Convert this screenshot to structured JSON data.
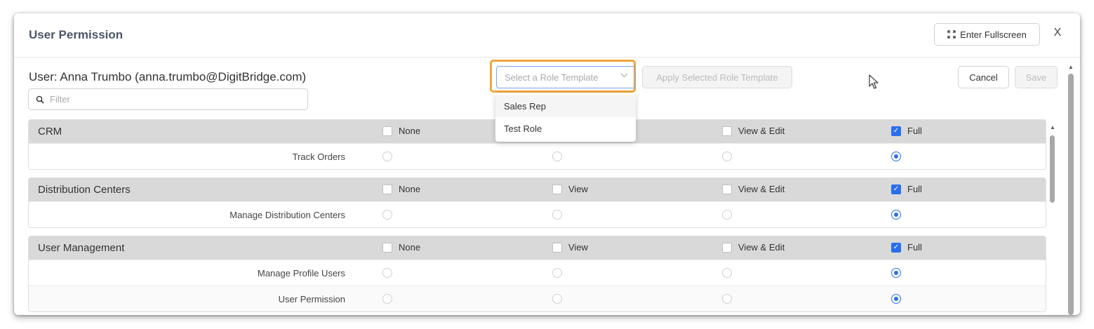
{
  "dialog": {
    "title": "User Permission",
    "fullscreen_label": "Enter Fullscreen",
    "close_label": "X"
  },
  "user_line": "User: Anna Trumbo (anna.trumbo@DigitBridge.com)",
  "filter": {
    "placeholder": "Filter"
  },
  "role_template": {
    "placeholder": "Select a Role Template",
    "options": [
      "Sales Rep",
      "Test Role"
    ]
  },
  "buttons": {
    "apply": "Apply Selected Role Template",
    "cancel": "Cancel",
    "save": "Save"
  },
  "sections": [
    {
      "title": "CRM",
      "header_options": [
        "None",
        "",
        "View & Edit",
        "Full"
      ],
      "header_checked": "Full",
      "rows": [
        {
          "label": "Track Orders",
          "selected": "Full"
        }
      ]
    },
    {
      "title": "Distribution Centers",
      "header_options": [
        "None",
        "View",
        "View & Edit",
        "Full"
      ],
      "header_checked": "Full",
      "rows": [
        {
          "label": "Manage Distribution Centers",
          "selected": "Full"
        }
      ]
    },
    {
      "title": "User Management",
      "header_options": [
        "None",
        "View",
        "View & Edit",
        "Full"
      ],
      "header_checked": "Full",
      "rows": [
        {
          "label": "Manage Profile Users",
          "selected": "Full"
        },
        {
          "label": "User Permission",
          "selected": "Full"
        }
      ]
    }
  ],
  "colors": {
    "accent_blue": "#2a6ef0",
    "highlight_orange": "#f0a53a",
    "section_header_bg": "#d9d9d9"
  },
  "icons": {
    "fullscreen": "expand-icon",
    "filter": "search-icon",
    "select": "chevron-down-icon",
    "cursor": "mouse-pointer-icon"
  }
}
